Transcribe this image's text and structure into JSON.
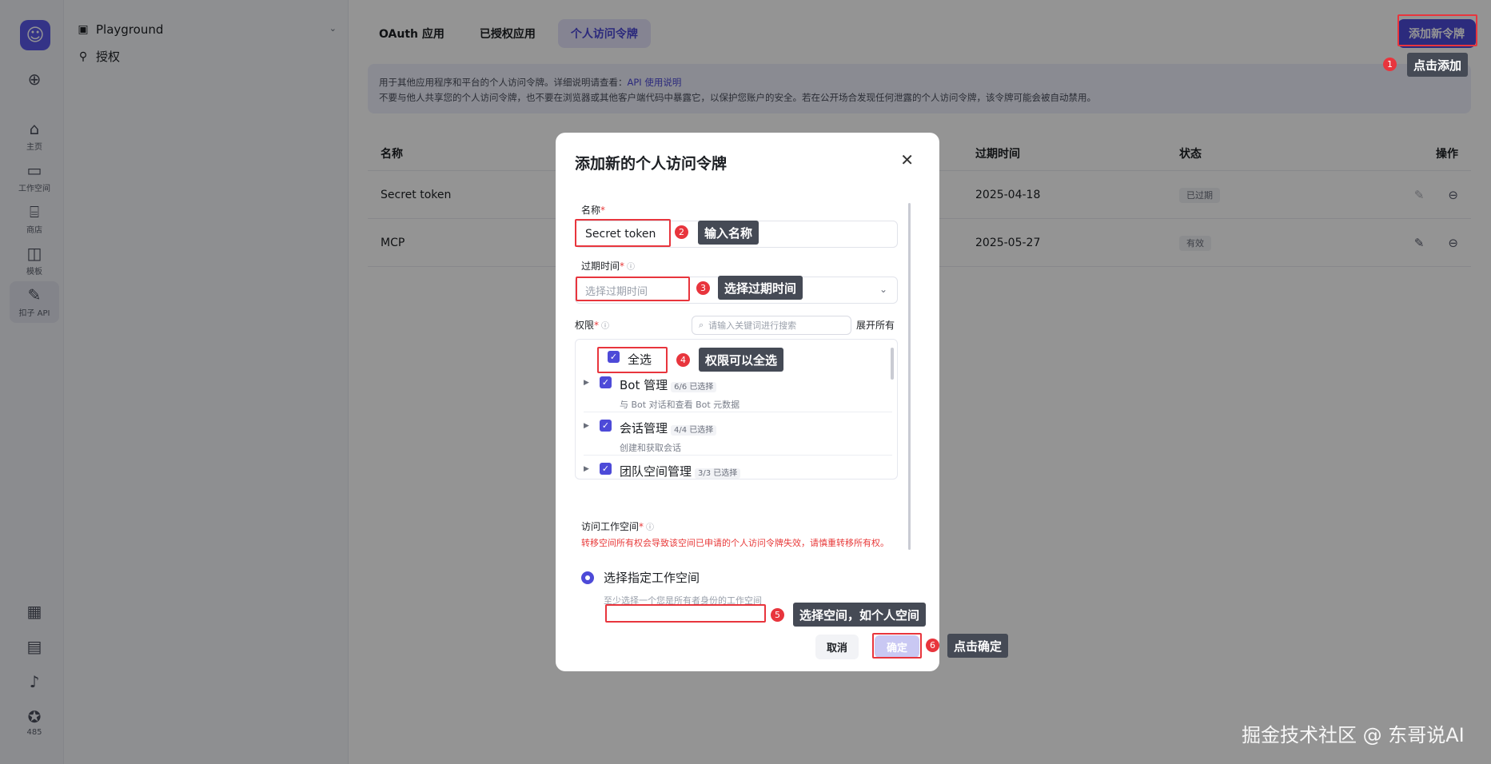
{
  "rail": {
    "items": [
      {
        "icon": "plus-circle-icon",
        "glyph": "⊕",
        "label": ""
      },
      {
        "icon": "home-icon",
        "glyph": "⌂",
        "label": "主页"
      },
      {
        "icon": "workspace-icon",
        "glyph": "▭",
        "label": "工作空间"
      },
      {
        "icon": "store-icon",
        "glyph": "⌸",
        "label": "商店"
      },
      {
        "icon": "template-icon",
        "glyph": "◫",
        "label": "模板"
      },
      {
        "icon": "api-icon",
        "glyph": "✎",
        "label": "扣子 API"
      },
      {
        "icon": "grid-icon",
        "glyph": "▦",
        "label": ""
      },
      {
        "icon": "doc-icon",
        "glyph": "▤",
        "label": ""
      },
      {
        "icon": "bell-icon",
        "glyph": "♪",
        "label": ""
      },
      {
        "icon": "star-icon",
        "glyph": "✪",
        "label": "485"
      }
    ]
  },
  "sidebar": {
    "items": [
      {
        "icon": "playground-icon",
        "glyph": "▣",
        "label": "Playground"
      },
      {
        "icon": "auth-icon",
        "glyph": "⚲",
        "label": "授权"
      }
    ]
  },
  "tabs": [
    {
      "label": "OAuth 应用"
    },
    {
      "label": "已授权应用"
    },
    {
      "label": "个人访问令牌"
    }
  ],
  "add_button": "添加新令牌",
  "notice": {
    "line1_text": "用于其他应用程序和平台的个人访问令牌。详细说明请查看：",
    "line1_link": "API 使用说明",
    "line2": "不要与他人共享您的个人访问令牌，也不要在浏览器或其他客户端代码中暴露它，以保护您账户的安全。若在公开场合发现任何泄露的个人访问令牌，该令牌可能会被自动禁用。"
  },
  "table": {
    "headers": {
      "name": "名称",
      "expire": "过期时间",
      "status": "状态",
      "actions": "操作"
    },
    "rows": [
      {
        "name": "Secret token",
        "expire": "2025-04-18",
        "status": "已过期"
      },
      {
        "name": "MCP",
        "expire": "2025-05-27",
        "status": "有效"
      }
    ]
  },
  "modal": {
    "title": "添加新的个人访问令牌",
    "name_label": "名称",
    "name_value": "Secret token",
    "expire_label": "过期时间",
    "expire_placeholder": "选择过期时间",
    "perm_label": "权限",
    "search_placeholder": "请输入关键词进行搜索",
    "expand_all": "展开所有",
    "select_all": "全选",
    "permissions": [
      {
        "title": "Bot 管理",
        "count": "6/6 已选择",
        "desc": "与 Bot 对话和查看 Bot 元数据"
      },
      {
        "title": "会话管理",
        "count": "4/4 已选择",
        "desc": "创建和获取会话"
      },
      {
        "title": "团队空间管理",
        "count": "3/3 已选择",
        "desc": ""
      }
    ],
    "workspace_label": "访问工作空间",
    "warning": "转移空间所有权会导致该空间已申请的个人访问令牌失效，请慎重转移所有权。",
    "radio_label": "选择指定工作空间",
    "hint": "至少选择一个您是所有者身份的工作空间",
    "cancel": "取消",
    "confirm": "确定"
  },
  "annotations": [
    {
      "num": "1",
      "text": "点击添加"
    },
    {
      "num": "2",
      "text": "输入名称"
    },
    {
      "num": "3",
      "text": "选择过期时间"
    },
    {
      "num": "4",
      "text": "权限可以全选"
    },
    {
      "num": "5",
      "text": "选择空间，如个人空间"
    },
    {
      "num": "6",
      "text": "点击确定"
    }
  ],
  "watermark": "掘金技术社区 @ 东哥说AI",
  "colors": {
    "accent": "#4d4ad8",
    "annotation": "#e8353d",
    "tooltip": "#454a55"
  }
}
